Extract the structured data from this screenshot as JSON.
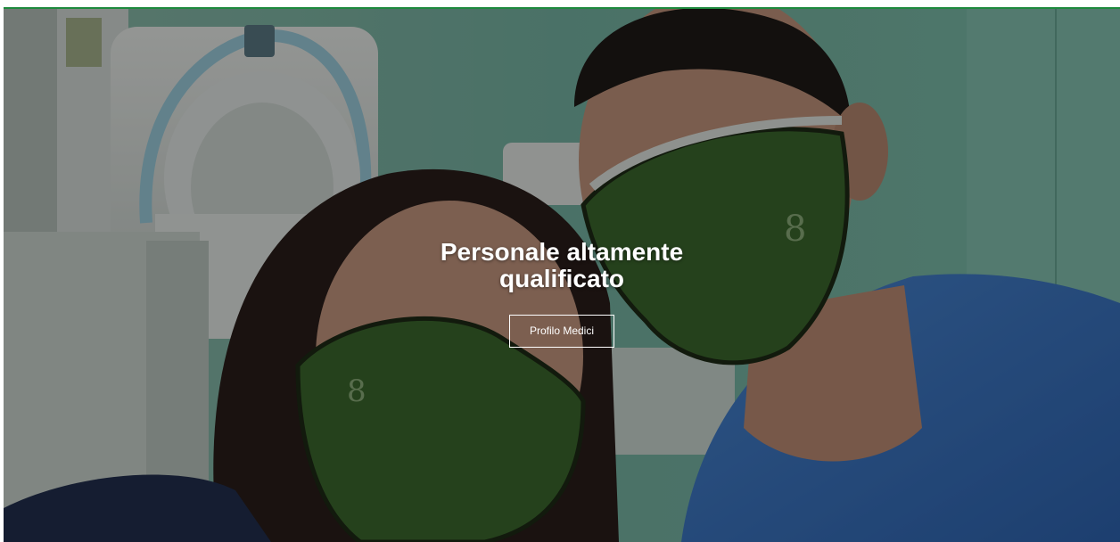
{
  "hero": {
    "title": "Personale altamente qualificato",
    "button_label": "Profilo Medici",
    "image_subject": "selfie-two-medical-staff-green-masks-mri-room",
    "colors": {
      "accent_line": "#1e8a3e",
      "wall": "#6fb3a1",
      "mask": "#3d6a2e",
      "scrubs": "#3d79c9",
      "overlay": "rgba(0,0,0,0.38)"
    }
  }
}
